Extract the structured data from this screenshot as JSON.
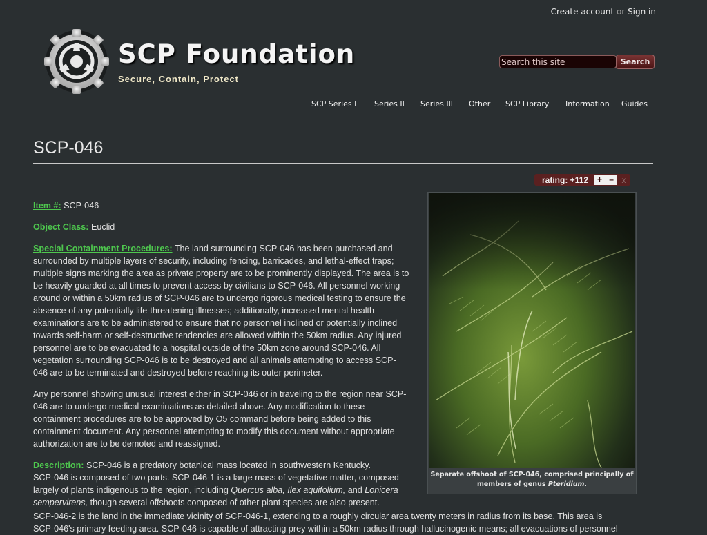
{
  "header": {
    "create_account": "Create account",
    "or": "or",
    "sign_in": "Sign in",
    "site_name": "SCP Foundation",
    "site_tagline": "Secure, Contain, Protect",
    "logo_icon": "scp-logo-icon",
    "search_placeholder": "Search this site",
    "search_button": "Search"
  },
  "nav": [
    "SCP Series I",
    "Series II",
    "Series III",
    "Other",
    "SCP Library",
    "Information",
    "Guides"
  ],
  "page": {
    "title": "SCP-046",
    "rating": {
      "label": "rating: +112",
      "plus": "+",
      "minus": "–",
      "close": "x"
    }
  },
  "article": {
    "item_label": "Item #:",
    "item_value": "SCP-046",
    "class_label": "Object Class:",
    "class_value": "Euclid",
    "scp_label": "Special Containment Procedures:",
    "scp_text": "The land surrounding SCP-046 has been purchased and surrounded by multiple layers of security, including fencing, barricades, and lethal-effect traps; multiple signs marking the area as private property are to be prominently displayed. The area is to be heavily guarded at all times to prevent access by civilians to SCP-046. All personnel working around or within a 50km radius of SCP-046 are to undergo rigorous medical testing to ensure the absence of any potentially life-threatening illnesses; additionally,  increased mental health examinations are to be administered to ensure that no personnel inclined or potentially inclined towards self-harm or self-destructive tendencies are allowed within the 50km radius. Any injured personnel are to be evacuated to a hospital outside of the 50km zone around SCP-046. All vegetation surrounding SCP-046 is to be destroyed and all animals attempting to access SCP-046 are to be terminated and destroyed before reaching its outer perimeter.",
    "scp_text2": "Any personnel showing unusual interest either in SCP-046 or in traveling to the region near SCP-046 are to undergo medical examinations as detailed above. Any modification to these containment procedures are to be approved by O5 command before being added to this containment document. Any personnel attempting to modify this document without appropriate authorization are to be demoted and reassigned.",
    "desc_label": "Description:",
    "desc_line1": "SCP-046 is a predatory botanical mass located in southwestern Kentucky.",
    "desc_line2a": "SCP-046 is composed of two parts. SCP-046-1 is a large mass of vegetative matter, composed largely of plants indigenous to the region, including ",
    "desc_species1": "Quercus alba, Ilex aquifolium,",
    "desc_and": " and ",
    "desc_species2": "Lonicera sempervirens,",
    "desc_line2b": " though several offshoots composed of other plant species are also present.",
    "desc_line3": "SCP-046-2 is the land in the immediate vicinity of SCP-046-1, extending to a roughly circular area twenty meters in radius from its base. This area is",
    "desc_line4": "SCP-046's primary feeding area. SCP-046 is capable of attracting prey within a 50km radius through hallucinogenic means; all evacuations of personnel"
  },
  "image": {
    "caption_main": "Separate offshoot of SCP-046, comprised principally of members of genus ",
    "caption_genus": "Pteridium",
    "caption_end": "."
  }
}
